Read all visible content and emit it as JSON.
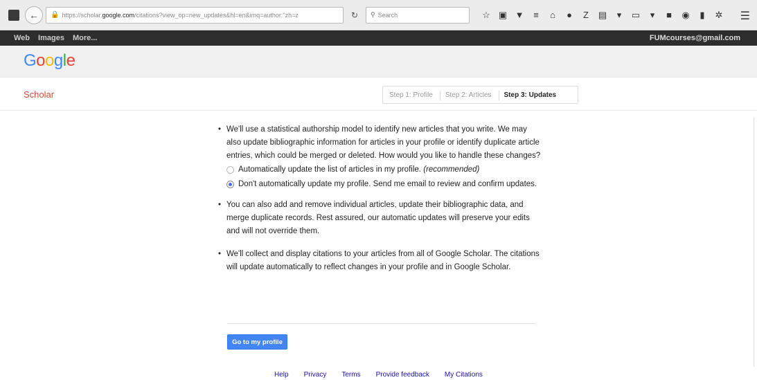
{
  "browser": {
    "url_prefix": "https://scholar.",
    "url_host": "google.com",
    "url_path": "/citations?view_op=new_updates&hl=en&imq=author:\"zh=z",
    "search_placeholder": "Search",
    "toolbar_icons": [
      "star-icon",
      "clipboard-icon",
      "pocket-icon",
      "library-icon",
      "home-icon",
      "chat-icon",
      "zotero-icon",
      "reader-icon",
      "dropdown-icon",
      "folder-icon",
      "dropdown-icon",
      "square-icon",
      "record-icon",
      "bookmark-icon",
      "extension-icon"
    ]
  },
  "gbar": {
    "links": [
      "Web",
      "Images",
      "More..."
    ],
    "email": "FUMcourses@gmail.com"
  },
  "header": {
    "logo_letters": [
      {
        "ch": "G",
        "color": "#4285f4"
      },
      {
        "ch": "o",
        "color": "#ea4335"
      },
      {
        "ch": "o",
        "color": "#fbbc05"
      },
      {
        "ch": "g",
        "color": "#4285f4"
      },
      {
        "ch": "l",
        "color": "#34a853"
      },
      {
        "ch": "e",
        "color": "#ea4335"
      }
    ],
    "product": "Scholar"
  },
  "steps": [
    {
      "label": "Step 1: Profile",
      "active": false
    },
    {
      "label": "Step 2: Articles",
      "active": false
    },
    {
      "label": "Step 3: Updates",
      "active": true
    }
  ],
  "content": {
    "bullet1": "We'll use a statistical authorship model to identify new articles that you write. We may also update bibliographic information for articles in your profile or identify duplicate article entries, which could be merged or deleted. How would you like to handle these changes?",
    "option1": "Automatically update the list of articles in my profile.",
    "option1_note": "(recommended)",
    "option2": "Don't automatically update my profile. Send me email to review and confirm updates.",
    "selected_option": 2,
    "bullet2": "You can also add and remove individual articles, update their bibliographic data, and merge duplicate records. Rest assured, our automatic updates will preserve your edits and will not override them.",
    "bullet3": "We'll collect and display citations to your articles from all of Google Scholar. The citations will update automatically to reflect changes in your profile and in Google Scholar.",
    "button": "Go to my profile"
  },
  "footer": [
    "Help",
    "Privacy",
    "Terms",
    "Provide feedback",
    "My Citations"
  ],
  "colors": {
    "accent": "#4285f4",
    "scholar_red": "#dd4b39",
    "gbar": "#2d2d2d",
    "link": "#1a0dab"
  }
}
